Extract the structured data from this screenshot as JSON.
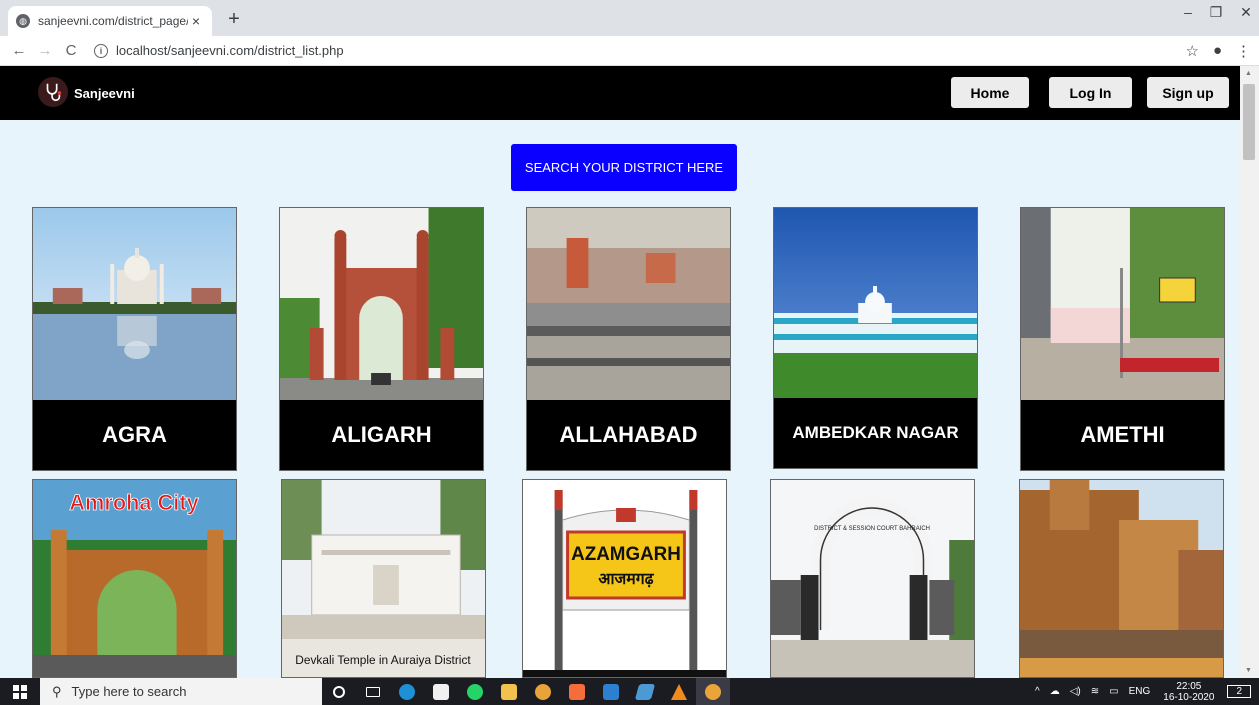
{
  "browser": {
    "tab_title": "sanjeevni.com/district_page/",
    "new_tab": "+",
    "url": "localhost/sanjeevni.com/district_list.php"
  },
  "site": {
    "brand": "Sanjeevni",
    "nav": {
      "home": "Home",
      "login": "Log In",
      "signup": "Sign up"
    },
    "search_button": "SEARCH YOUR DISTRICT HERE"
  },
  "districts": [
    {
      "name": "AGRA"
    },
    {
      "name": "ALIGARH"
    },
    {
      "name": "ALLAHABAD"
    },
    {
      "name": "AMBEDKAR NAGAR"
    },
    {
      "name": "AMETHI"
    },
    {
      "name": "",
      "image_text": "Amroha City"
    },
    {
      "name": "",
      "image_text": "Devkali Temple in Auraiya District"
    },
    {
      "name": "",
      "image_text_en": "AZAMGARH",
      "image_text_hi": "आजमगढ़"
    },
    {
      "name": "",
      "image_text": "DISTRICT & SESSION COURT BAHRAICH"
    },
    {
      "name": ""
    }
  ],
  "taskbar": {
    "search_placeholder": "Type here to search",
    "language": "ENG",
    "time": "22:05",
    "date": "16-10-2020",
    "notification_count": "2"
  }
}
